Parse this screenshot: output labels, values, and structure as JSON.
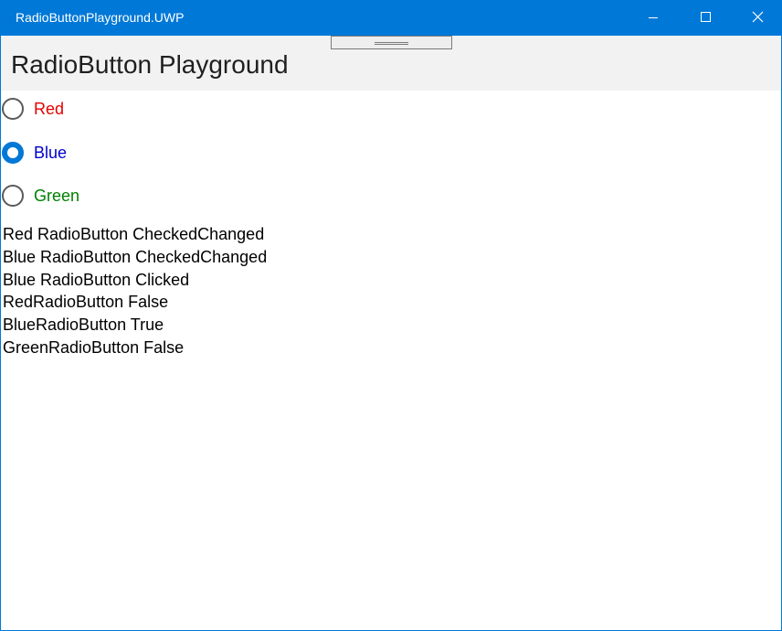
{
  "window": {
    "title": "RadioButtonPlayground.UWP",
    "accent_color": "#0078d7"
  },
  "header": {
    "page_title": "RadioButton Playground"
  },
  "radios": [
    {
      "label": "Red",
      "color": "#e60000",
      "checked": false
    },
    {
      "label": "Blue",
      "color": "#0000cc",
      "checked": true
    },
    {
      "label": "Green",
      "color": "#008000",
      "checked": false
    }
  ],
  "log": [
    "Red RadioButton CheckedChanged",
    "Blue RadioButton CheckedChanged",
    "Blue RadioButton Clicked",
    "RedRadioButton False",
    "BlueRadioButton True",
    "GreenRadioButton False"
  ]
}
